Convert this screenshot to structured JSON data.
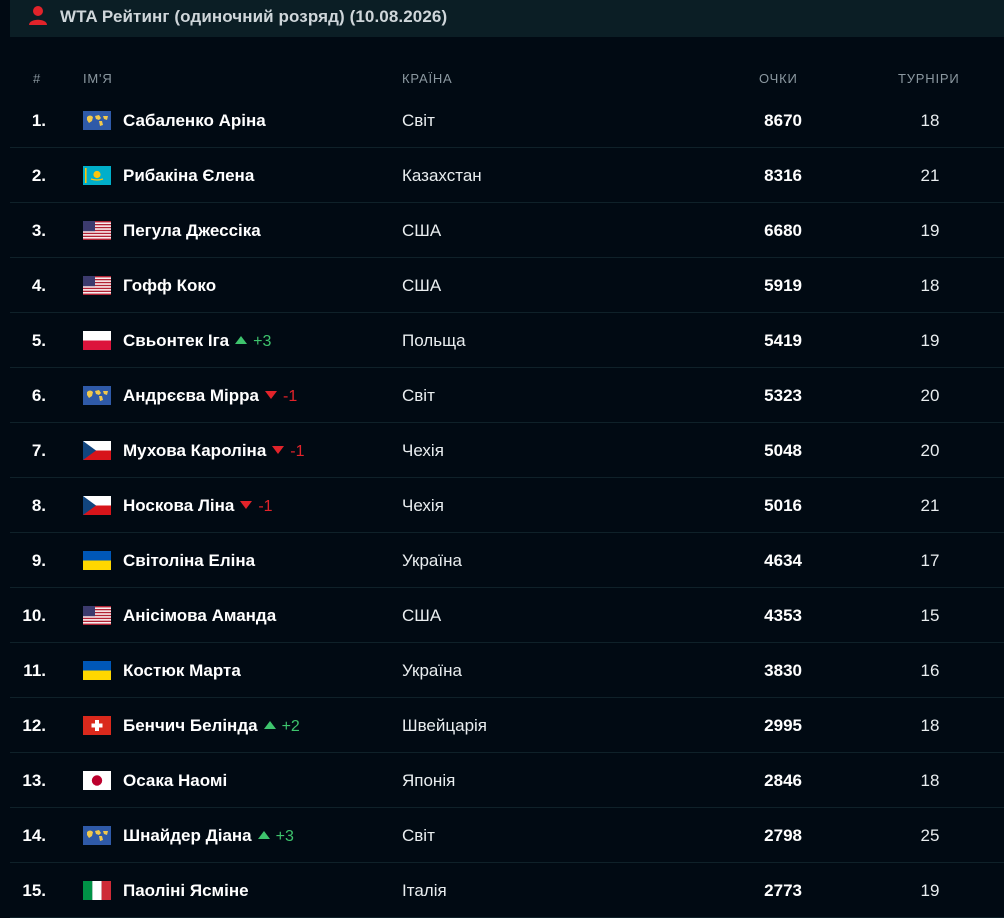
{
  "header": {
    "title": "WTA Рейтинг (одиночний розряд) (10.08.2026)",
    "icon": "person-icon"
  },
  "columns": {
    "rank": "#",
    "name": "ІМ'Я",
    "country": "КРАЇНА",
    "points": "ОЧКИ",
    "tournaments": "ТУРНІРИ"
  },
  "colors": {
    "up": "#3ec46d",
    "down": "#e2232a",
    "icon": "#e2232a"
  },
  "rows": [
    {
      "rank": "1.",
      "flag": "world",
      "name": "Сабаленко Аріна",
      "dir": "",
      "change": "",
      "country": "Світ",
      "points": "8670",
      "tournaments": "18"
    },
    {
      "rank": "2.",
      "flag": "kazakhstan",
      "name": "Рибакіна Єлена",
      "dir": "",
      "change": "",
      "country": "Казахстан",
      "points": "8316",
      "tournaments": "21"
    },
    {
      "rank": "3.",
      "flag": "usa",
      "name": "Пегула Джессіка",
      "dir": "",
      "change": "",
      "country": "США",
      "points": "6680",
      "tournaments": "19"
    },
    {
      "rank": "4.",
      "flag": "usa",
      "name": "Гофф Коко",
      "dir": "",
      "change": "",
      "country": "США",
      "points": "5919",
      "tournaments": "18"
    },
    {
      "rank": "5.",
      "flag": "poland",
      "name": "Свьонтек Іга",
      "dir": "up",
      "change": "+3",
      "country": "Польща",
      "points": "5419",
      "tournaments": "19"
    },
    {
      "rank": "6.",
      "flag": "world",
      "name": "Андрєєва Мірра",
      "dir": "down",
      "change": "-1",
      "country": "Світ",
      "points": "5323",
      "tournaments": "20"
    },
    {
      "rank": "7.",
      "flag": "czech",
      "name": "Мухова Кароліна",
      "dir": "down",
      "change": "-1",
      "country": "Чехія",
      "points": "5048",
      "tournaments": "20"
    },
    {
      "rank": "8.",
      "flag": "czech",
      "name": "Носкова Ліна",
      "dir": "down",
      "change": "-1",
      "country": "Чехія",
      "points": "5016",
      "tournaments": "21"
    },
    {
      "rank": "9.",
      "flag": "ukraine",
      "name": "Світоліна Еліна",
      "dir": "",
      "change": "",
      "country": "Україна",
      "points": "4634",
      "tournaments": "17"
    },
    {
      "rank": "10.",
      "flag": "usa",
      "name": "Анісімова Аманда",
      "dir": "",
      "change": "",
      "country": "США",
      "points": "4353",
      "tournaments": "15"
    },
    {
      "rank": "11.",
      "flag": "ukraine",
      "name": "Костюк Марта",
      "dir": "",
      "change": "",
      "country": "Україна",
      "points": "3830",
      "tournaments": "16"
    },
    {
      "rank": "12.",
      "flag": "switzerland",
      "name": "Бенчич Белінда",
      "dir": "up",
      "change": "+2",
      "country": "Швейцарія",
      "points": "2995",
      "tournaments": "18"
    },
    {
      "rank": "13.",
      "flag": "japan",
      "name": "Осака Наомі",
      "dir": "",
      "change": "",
      "country": "Японія",
      "points": "2846",
      "tournaments": "18"
    },
    {
      "rank": "14.",
      "flag": "world",
      "name": "Шнайдер Діана",
      "dir": "up",
      "change": "+3",
      "country": "Світ",
      "points": "2798",
      "tournaments": "25"
    },
    {
      "rank": "15.",
      "flag": "italy",
      "name": "Паоліні Ясміне",
      "dir": "",
      "change": "",
      "country": "Італія",
      "points": "2773",
      "tournaments": "19"
    }
  ]
}
